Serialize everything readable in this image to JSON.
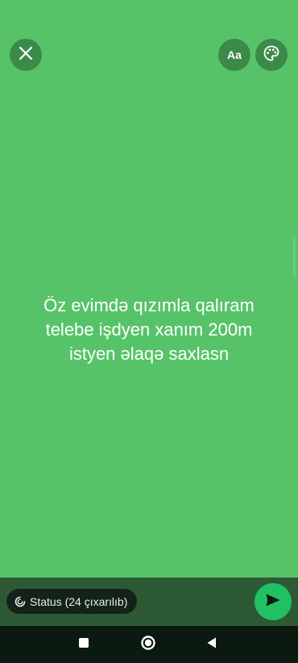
{
  "colors": {
    "background": "#57c368",
    "overlay_button": "#3c8a4a",
    "bottom_bar": "#2d5a35",
    "pill": "#14231a",
    "send_button": "#21c063",
    "nav_bar": "#0b1a10"
  },
  "toolbar": {
    "close_icon": "close-icon",
    "font_button_label": "Aa",
    "palette_icon": "palette-icon"
  },
  "status": {
    "text": "Öz evimdə qızımla qalıram\ntelebe işdyen xanım  200m\nistyen əlaqə saxlasn"
  },
  "bottom": {
    "audience_label": "Status (24 çıxarılıb)",
    "audience_icon": "status-ring-icon",
    "send_icon": "send-icon"
  },
  "navigation": {
    "recents_icon": "square-icon",
    "home_icon": "circle-icon",
    "back_icon": "triangle-back-icon"
  }
}
